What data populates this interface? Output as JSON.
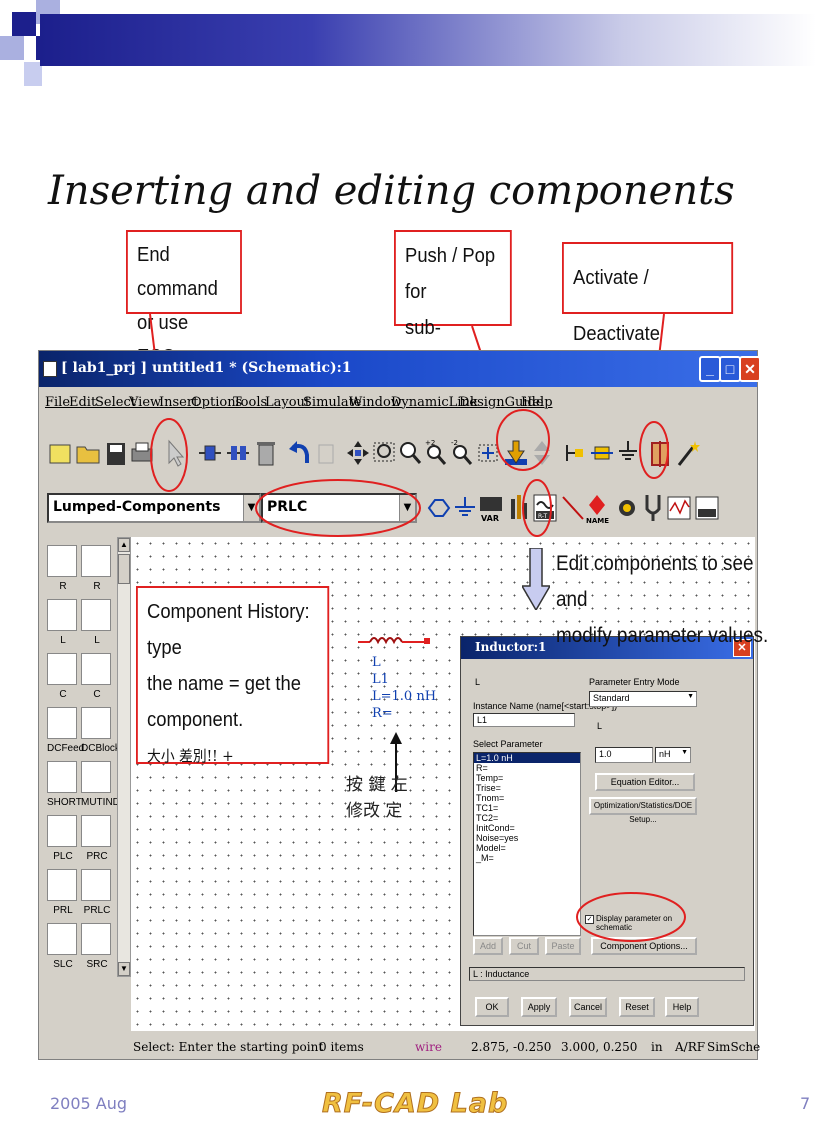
{
  "slide": {
    "title": "Inserting and editing components",
    "footer_date": "2005 Aug",
    "footer_logo": "RF-CAD Lab",
    "page_number": "7"
  },
  "callouts": {
    "end_command_line1": "End command",
    "end_command_line2": "or use ESC",
    "push_pop_line1": "Push / Pop for",
    "push_pop_line2": "sub-circuits.",
    "activate": "Activate / Deactivate",
    "edit_line1": "Edit components to see and",
    "edit_line2": "modify parameter values.",
    "history_line1": "Component History: type",
    "history_line2": "the name = get the",
    "history_line3": "component.",
    "history_handwriting": "大小    差別!! +",
    "handwriting_note1": "按  鍵  左",
    "handwriting_note2": "修改  定",
    "handwriting_note3": "1    ↑"
  },
  "window": {
    "title": "[ lab1_prj ] untitled1 * (Schematic):1",
    "menu": [
      "File",
      "Edit",
      "Select",
      "View",
      "Insert",
      "Options",
      "Tools",
      "Layout",
      "Simulate",
      "Window",
      "DynamicLink",
      "DesignGuide",
      "Help"
    ],
    "library_combo": "Lumped-Components",
    "history_combo": "PRLC",
    "palette": [
      {
        "label": "R"
      },
      {
        "label": "R"
      },
      {
        "label": "L"
      },
      {
        "label": "L"
      },
      {
        "label": "C"
      },
      {
        "label": "C"
      },
      {
        "label": "DCFeed"
      },
      {
        "label": "DCBlock"
      },
      {
        "label": "SHORT"
      },
      {
        "label": "MUTIND"
      },
      {
        "label": "PLC"
      },
      {
        "label": "PRC"
      },
      {
        "label": "PRL"
      },
      {
        "label": "PRLC"
      },
      {
        "label": "SLC"
      },
      {
        "label": "SRC"
      }
    ],
    "status": {
      "prompt": "Select: Enter the starting point",
      "items": "0 items",
      "mode": "wire",
      "coord1": "2.875, -0.250",
      "coord2": "3.000, 0.250",
      "unit": "in",
      "sim": "A/RF",
      "sch": "SimSche"
    }
  },
  "schematic_inductor": {
    "type": "L",
    "name": "L1",
    "value": "L=1.0 nH",
    "r": "R="
  },
  "dialog": {
    "title": "Inductor:1",
    "component": "L",
    "instance_name_label": "Instance Name (name[<start:stop>])",
    "instance_name_value": "L1",
    "select_parameter_label": "Select Parameter",
    "parameters": [
      "L=1.0 nH",
      "R=",
      "Temp=",
      "Trise=",
      "Tnom=",
      "TC1=",
      "TC2=",
      "InitCond=",
      "Noise=yes",
      "Model=",
      "_M="
    ],
    "entry_mode_label": "Parameter Entry Mode",
    "entry_mode_value": "Standard",
    "param_name": "L",
    "param_value": "1.0",
    "param_unit": "nH",
    "equation_editor": "Equation Editor...",
    "optimization_setup": "Optimization/Statistics/DOE Setup...",
    "display_checkbox": "Display parameter on schematic",
    "add": "Add",
    "cut": "Cut",
    "paste": "Paste",
    "component_options": "Component Options...",
    "description": "L : Inductance",
    "ok": "OK",
    "apply": "Apply",
    "cancel": "Cancel",
    "reset": "Reset",
    "help": "Help"
  },
  "colors": {
    "accent_blue": "#1c1f8c",
    "callout_red": "#e02020",
    "title_bar": "#0a246a",
    "footer": "#7f7fc0",
    "logo_gold": "#f0c040"
  }
}
